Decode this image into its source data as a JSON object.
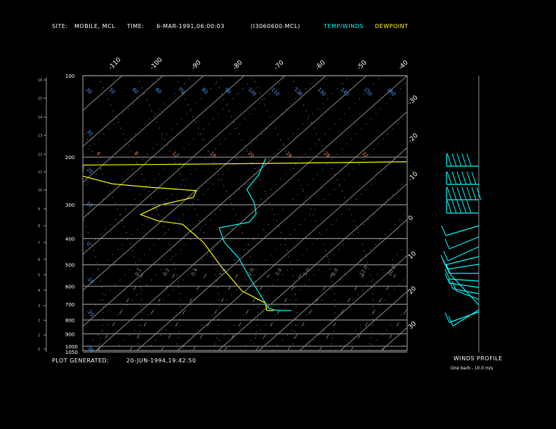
{
  "header": {
    "site_label": "SITE:",
    "site_value": "MOBILE, MCL",
    "time_label": "TIME:",
    "time_value": "6-MAR-1991,06:00:03",
    "file": "(I3060600.MCL)",
    "legend_temp": "TEMP/WINDS",
    "legend_dew": "DEWPOINT"
  },
  "footer": {
    "generated_label": "PLOT GENERATED:",
    "generated_value": "20-JUN-1994,19:42:50"
  },
  "winds": {
    "title": "WINDS PROFILE",
    "note": "One barb - 10.0 m/s"
  },
  "colors": {
    "temp": "#00ffff",
    "dewpoint": "#ffff00",
    "isobar": "#909090",
    "dry_adiabat": "#4a9eff",
    "moist_adiabat": "#ff8c50",
    "mixing_ratio": "#808080"
  },
  "chart_data": {
    "type": "line",
    "subtype": "skew-T log-p",
    "y_scale": "log",
    "ylim_hpa": [
      100,
      1050
    ],
    "pressure_labels": [
      "100",
      "200",
      "300",
      "400",
      "500",
      "600",
      "700",
      "800",
      "900",
      "1000",
      "1050"
    ],
    "pressure_values": [
      100,
      200,
      300,
      400,
      500,
      600,
      700,
      800,
      900,
      1000,
      1050
    ],
    "height_labels_km": [
      "16",
      "15",
      "14",
      "13",
      "12",
      "11",
      "10",
      "9",
      "8",
      "7",
      "6",
      "5",
      "4",
      "3",
      "2",
      "1",
      "0"
    ],
    "isotherm_top_labels": [
      "-110",
      "-100",
      "-90",
      "-80",
      "-70",
      "-60",
      "-50",
      "-40"
    ],
    "isotherm_right_labels": [
      "-30",
      "-20",
      "-10",
      "0",
      "10",
      "20",
      "30"
    ],
    "dry_adiabat_labels": [
      "30",
      "50",
      "60",
      "60",
      "70",
      "80",
      "90",
      "100",
      "110",
      "120",
      "130",
      "140",
      "150",
      "160"
    ],
    "dry_adiabat_left_labels": [
      "30",
      "20",
      "10",
      "0",
      "-10",
      "-20",
      "-30",
      "-40"
    ],
    "moist_adiabat_labels": [
      "4",
      "8",
      "12",
      "16",
      "20",
      "24",
      "28",
      "32"
    ],
    "mixing_ratio_labels": [
      "0.1",
      "0.2",
      "0.4",
      "1.0",
      "2.0",
      "3.0",
      "5.0",
      "8.0",
      "12.0",
      "20.0"
    ],
    "series": [
      {
        "name": "TEMP/WINDS",
        "color": "#00ffff",
        "points": [
          [
            202,
            -51.8
          ],
          [
            233,
            -48.9
          ],
          [
            263,
            -47.8
          ],
          [
            296,
            -42.1
          ],
          [
            324,
            -38.7
          ],
          [
            348,
            -38.1
          ],
          [
            365,
            -43.9
          ],
          [
            412,
            -38.7
          ],
          [
            472,
            -30.7
          ],
          [
            554,
            -22.9
          ],
          [
            652,
            -14.7
          ],
          [
            725,
            -9.3
          ],
          [
            738,
            -6.6
          ],
          [
            738,
            -3.2
          ]
        ]
      },
      {
        "name": "DEWPOINT",
        "color": "#ffff00",
        "points": [
          [
            208,
            -16.0
          ],
          [
            211,
            -50.1
          ],
          [
            212,
            -63.7
          ],
          [
            214,
            -94.7
          ],
          [
            235,
            -91.8
          ],
          [
            251,
            -82.4
          ],
          [
            258,
            -72.8
          ],
          [
            266,
            -59.8
          ],
          [
            282,
            -58.7
          ],
          [
            300,
            -64.5
          ],
          [
            326,
            -66.9
          ],
          [
            344,
            -60.9
          ],
          [
            354,
            -53.9
          ],
          [
            414,
            -43.6
          ],
          [
            507,
            -32.7
          ],
          [
            625,
            -20.7
          ],
          [
            692,
            -11.7
          ],
          [
            738,
            -9.2
          ],
          [
            738,
            -7.5
          ]
        ]
      }
    ]
  }
}
